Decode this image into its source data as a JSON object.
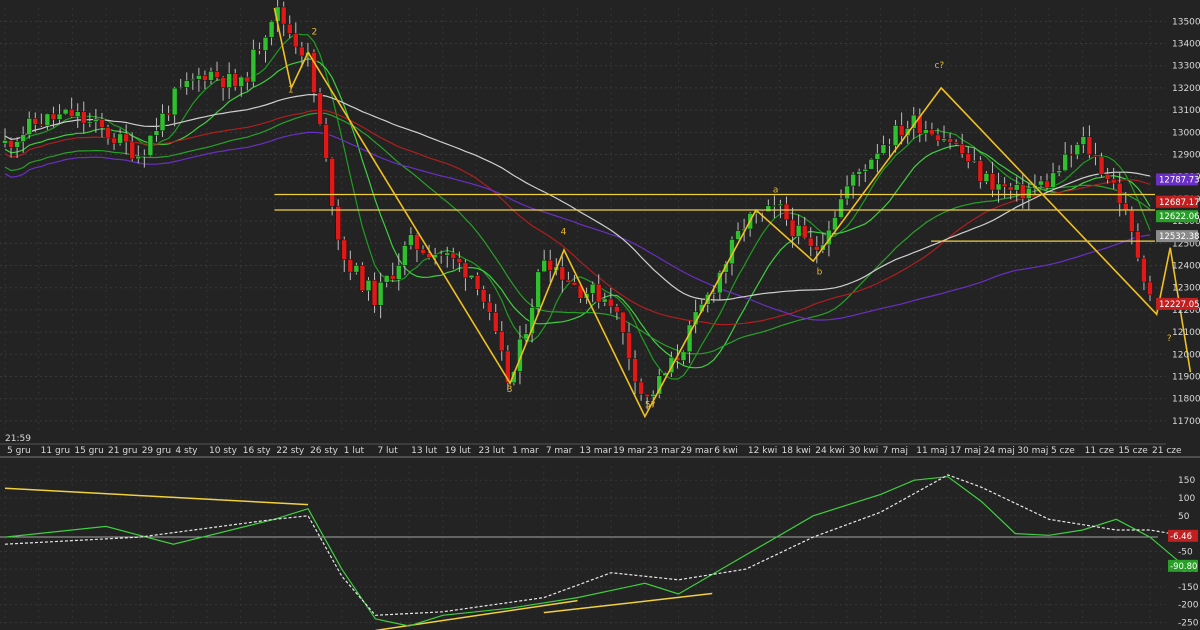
{
  "time_label": "21:59",
  "price_ticks": [
    "13500",
    "13400",
    "13300",
    "13200",
    "13100",
    "13000",
    "12900",
    "12800",
    "12700",
    "12600",
    "12500",
    "12400",
    "12300",
    "12200",
    "12100",
    "12000",
    "11900",
    "11800",
    "11700"
  ],
  "price_boxes": [
    {
      "text": "12787.73",
      "value": 12787.73,
      "color": "#6a2fc4"
    },
    {
      "text": "12687.17",
      "value": 12687.17,
      "color": "#c02020"
    },
    {
      "text": "12622.06",
      "value": 12622.06,
      "color": "#28a028"
    },
    {
      "text": "12532.38",
      "value": 12532.38,
      "color": "#8a8a8a"
    },
    {
      "text": "12227.05",
      "value": 12227.05,
      "color": "#c02020"
    }
  ],
  "date_labels": [
    "5 gru",
    "11 gru",
    "15 gru",
    "21 gru",
    "29 gru",
    "4 sty",
    "10 sty",
    "16 sty",
    "22 sty",
    "26 sty",
    "1 lut",
    "7 lut",
    "13 lut",
    "19 lut",
    "23 lut",
    "1 mar",
    "7 mar",
    "13 mar",
    "19 mar",
    "23 mar",
    "29 mar",
    "6 kwi",
    "12 kwi",
    "18 kwi",
    "24 kwi",
    "30 kwi",
    "7 maj",
    "11 maj",
    "17 maj",
    "24 maj",
    "30 maj",
    "5 cze",
    "11 cze",
    "15 cze",
    "21 cze"
  ],
  "wave_labels": [
    "1",
    "2",
    "3",
    "4",
    "5?",
    "a",
    "b",
    "c?",
    "?"
  ],
  "osc_ticks": [
    "150",
    "100",
    "50",
    "-50",
    "-100",
    "-150",
    "-200",
    "-250"
  ],
  "osc_boxes": [
    {
      "text": "-6.46",
      "value": -6.46,
      "color": "#c02020"
    },
    {
      "text": "-90.80",
      "value": -90.8,
      "color": "#28a028"
    }
  ],
  "colors": {
    "up": "#2fbf2f",
    "down": "#e01818",
    "wave": "#f0c020",
    "ma_fast": "#1e9e1e",
    "ma_mid": "#3fcf3f",
    "ma_long_green": "#28a028",
    "ma_red": "#b01e1e",
    "ma_purple": "#6a2fc4",
    "ma_white": "#cfcfcf",
    "hline": "#f0d040",
    "osc_line": "#3fcf3f",
    "osc_signal": "#e8e8e8"
  },
  "chart_data": [
    {
      "type": "candlestick",
      "ylim": [
        11650,
        13560
      ],
      "grid": true,
      "x_categories": [
        "5 gru",
        "11 gru",
        "15 gru",
        "21 gru",
        "29 gru",
        "4 sty",
        "10 sty",
        "16 sty",
        "22 sty",
        "26 sty",
        "1 lut",
        "7 lut",
        "13 lut",
        "19 lut",
        "23 lut",
        "1 mar",
        "7 mar",
        "13 mar",
        "19 mar",
        "23 mar",
        "29 mar",
        "6 kwi",
        "12 kwi",
        "18 kwi",
        "24 kwi",
        "30 kwi",
        "7 maj",
        "11 maj",
        "17 maj",
        "24 maj",
        "30 maj",
        "5 cze",
        "11 cze",
        "15 cze",
        "21 cze"
      ],
      "close_path": [
        [
          0,
          12950
        ],
        [
          1,
          13050
        ],
        [
          2,
          13080
        ],
        [
          3,
          13000
        ],
        [
          4,
          12900
        ],
        [
          5,
          13150
        ],
        [
          6,
          13280
        ],
        [
          7,
          13200
        ],
        [
          8,
          13560
        ],
        [
          9,
          13330
        ],
        [
          10,
          12450
        ],
        [
          11,
          12250
        ],
        [
          12,
          12500
        ],
        [
          13,
          12450
        ],
        [
          14,
          12350
        ],
        [
          15,
          11850
        ],
        [
          16,
          12450
        ],
        [
          17,
          12300
        ],
        [
          18,
          12250
        ],
        [
          19,
          11780
        ],
        [
          20,
          12000
        ],
        [
          21,
          12300
        ],
        [
          22,
          12600
        ],
        [
          23,
          12650
        ],
        [
          24,
          12450
        ],
        [
          25,
          12750
        ],
        [
          26,
          12950
        ],
        [
          27,
          13050
        ],
        [
          28,
          12980
        ],
        [
          29,
          12800
        ],
        [
          30,
          12720
        ],
        [
          31,
          12780
        ],
        [
          32,
          12960
        ],
        [
          33,
          12750
        ],
        [
          34,
          12280
        ]
      ],
      "wave_path": [
        [
          8,
          13560
        ],
        [
          8.5,
          13200
        ],
        [
          9,
          13360
        ],
        [
          15,
          11870
        ],
        [
          16.6,
          12470
        ],
        [
          19,
          11720
        ],
        [
          22.3,
          12650
        ],
        [
          24,
          12420
        ],
        [
          27.8,
          13200
        ],
        [
          34.2,
          12180
        ],
        [
          34.6,
          12480
        ],
        [
          35.2,
          11920
        ]
      ],
      "horizontal_levels": [
        12720,
        12650,
        12510
      ]
    },
    {
      "type": "line",
      "ylim": [
        -260,
        190
      ],
      "series": [
        {
          "values": [
            [
              0,
              -10
            ],
            [
              3,
              20
            ],
            [
              5,
              -30
            ],
            [
              8,
              40
            ],
            [
              9,
              70
            ],
            [
              10,
              -100
            ],
            [
              11,
              -240
            ],
            [
              12,
              -260
            ],
            [
              13,
              -230
            ],
            [
              15,
              -210
            ],
            [
              17,
              -180
            ],
            [
              19,
              -140
            ],
            [
              20,
              -170
            ],
            [
              22,
              -60
            ],
            [
              24,
              50
            ],
            [
              26,
              110
            ],
            [
              27,
              150
            ],
            [
              28,
              160
            ],
            [
              29,
              90
            ],
            [
              30,
              0
            ],
            [
              31,
              -5
            ],
            [
              32,
              10
            ],
            [
              33,
              40
            ],
            [
              34,
              -10
            ],
            [
              35,
              -90
            ]
          ]
        },
        {
          "values": [
            [
              0,
              -30
            ],
            [
              4,
              -10
            ],
            [
              8,
              40
            ],
            [
              9,
              50
            ],
            [
              10,
              -120
            ],
            [
              11,
              -230
            ],
            [
              13,
              -220
            ],
            [
              16,
              -180
            ],
            [
              18,
              -110
            ],
            [
              20,
              -130
            ],
            [
              22,
              -100
            ],
            [
              24,
              -10
            ],
            [
              26,
              60
            ],
            [
              28,
              165
            ],
            [
              29,
              130
            ],
            [
              31,
              40
            ],
            [
              33,
              10
            ],
            [
              34,
              10
            ],
            [
              35,
              -6
            ]
          ]
        }
      ]
    }
  ]
}
